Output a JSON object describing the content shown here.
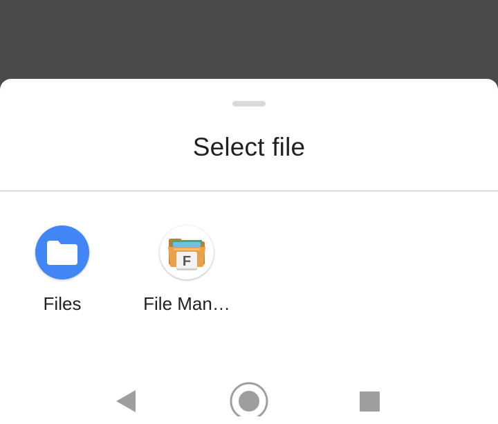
{
  "sheet": {
    "title": "Select file"
  },
  "apps": [
    {
      "label": "Files",
      "icon": "folder-icon",
      "color": "#4285f4"
    },
    {
      "label": "File Man…",
      "icon": "file-manager-icon",
      "color": "#e0933a"
    }
  ],
  "navbar": {
    "back": "back-icon",
    "home": "home-icon",
    "recents": "recents-icon"
  },
  "colors": {
    "scrim": "#4a4a4a",
    "sheet": "#ffffff",
    "nav_icons": "#9e9e9e"
  }
}
